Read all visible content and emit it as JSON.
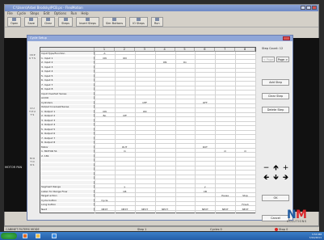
{
  "app": {
    "title": "C:\\Users\\Arbel Brodsky\\PCB.ps - FlexMotion",
    "menu": [
      "File",
      "Cycle",
      "Steps",
      "Edit",
      "Options",
      "Run",
      "Help"
    ],
    "toolbar": [
      "Open",
      "Save",
      "Clear",
      "Steps",
      "Insert Steps",
      "Sim Buttons",
      "IO Steps",
      "Run"
    ]
  },
  "dialog": {
    "title": "Cycle Setup",
    "step_count_label": "Step Count",
    "step_count_value": "12",
    "prev_page": "< Page",
    "next_page": "Page >",
    "buttons": {
      "add_step": "Add Step",
      "clear_step": "Clear Step",
      "delete_step": "Delete Step",
      "ok": "OK",
      "cancel": "Cancel"
    }
  },
  "grid": {
    "columns": [
      "",
      "1",
      "2",
      "3",
      "4",
      "5",
      "6",
      "7",
      "8"
    ],
    "rows": [
      {
        "name": "Input Type/Function",
        "cells": [
          "",
          "A",
          "",
          "",
          "",
          "",
          "",
          "",
          ""
        ]
      },
      {
        "name": "1. Input 1",
        "cells": [
          "",
          "ON",
          "ON",
          "",
          "",
          "",
          "",
          "",
          ""
        ]
      },
      {
        "name": "2. Input 2",
        "cells": [
          "",
          "",
          "",
          "",
          "ON",
          "On",
          "",
          "",
          ""
        ]
      },
      {
        "name": "3. Input 3",
        "cells": [
          "",
          "",
          "",
          "",
          "",
          "",
          "",
          "",
          ""
        ]
      },
      {
        "name": "4. Input 4",
        "cells": [
          "",
          "",
          "",
          "",
          "",
          "",
          "",
          "",
          ""
        ]
      },
      {
        "name": "5. Input 5",
        "cells": [
          "",
          "",
          "",
          "",
          "",
          "",
          "",
          "",
          ""
        ]
      },
      {
        "name": "6. Input 6",
        "cells": [
          "",
          "",
          "",
          "",
          "",
          "",
          "",
          "",
          ""
        ]
      },
      {
        "name": "7. Input 7",
        "cells": [
          "",
          "",
          "",
          "",
          "",
          "",
          "",
          "",
          ""
        ]
      },
      {
        "name": "8. Input 8",
        "cells": [
          "",
          "",
          "",
          "",
          "",
          "",
          "",
          "",
          ""
        ]
      },
      {
        "name": "Input Inverted Sense",
        "cells": [
          "",
          "",
          "",
          "",
          "",
          "",
          "",
          "",
          ""
        ]
      },
      {
        "name": "Air/Oil",
        "cells": [
          "",
          "",
          "",
          "",
          "",
          "",
          "",
          "",
          ""
        ]
      },
      {
        "name": "Cylinders",
        "cells": [
          "",
          "",
          "",
          "OFF",
          "",
          "",
          "OFF",
          "",
          ""
        ]
      },
      {
        "name": "Output Inversed/Sense",
        "cells": [
          "",
          "",
          "",
          "",
          "",
          "",
          "",
          "",
          ""
        ]
      },
      {
        "name": "1. Output 1",
        "cells": [
          "",
          "ON",
          "",
          "ON",
          "",
          "",
          "",
          "",
          ""
        ]
      },
      {
        "name": "2. Output 2",
        "cells": [
          "",
          "Bo",
          "Off",
          "",
          "",
          "",
          "",
          "",
          ""
        ]
      },
      {
        "name": "3. Output 3",
        "cells": [
          "",
          "",
          "",
          "",
          "",
          "",
          "",
          "",
          ""
        ]
      },
      {
        "name": "4. Output 4",
        "cells": [
          "",
          "",
          "",
          "",
          "",
          "",
          "",
          "",
          ""
        ]
      },
      {
        "name": "5. Output 5",
        "cells": [
          "",
          "",
          "",
          "",
          "",
          "",
          "",
          "",
          ""
        ]
      },
      {
        "name": "6. Output 6",
        "cells": [
          "",
          "",
          "",
          "",
          "",
          "",
          "",
          "",
          ""
        ]
      },
      {
        "name": "7. Output 7",
        "cells": [
          "",
          "",
          "",
          "",
          "",
          "",
          "",
          "",
          ""
        ]
      },
      {
        "name": "8. Output 8",
        "cells": [
          "",
          "",
          "",
          "",
          "",
          "",
          "",
          "",
          ""
        ]
      },
      {
        "name": "Motor",
        "cells": [
          "",
          "",
          "RUT",
          "",
          "",
          "",
          "RUT",
          "",
          ""
        ]
      },
      {
        "name": "1. MOTOR 51",
        "cells": [
          "",
          "",
          "m",
          "",
          "",
          "",
          "",
          "m",
          "m"
        ]
      },
      {
        "name": "2. 181",
        "cells": [
          "",
          "",
          "",
          "",
          "",
          "",
          "",
          "",
          ""
        ]
      },
      {
        "name": "",
        "cells": [
          "",
          "",
          "",
          "",
          "",
          "",
          "",
          "",
          ""
        ]
      },
      {
        "name": "",
        "cells": [
          "",
          "",
          "",
          "",
          "",
          "",
          "",
          "",
          ""
        ]
      },
      {
        "name": "",
        "cells": [
          "",
          "",
          "",
          "",
          "",
          "",
          "",
          "",
          ""
        ]
      },
      {
        "name": "",
        "cells": [
          "",
          "",
          "",
          "",
          "",
          "",
          "",
          "",
          ""
        ]
      },
      {
        "name": "",
        "cells": [
          "",
          "",
          "",
          "",
          "",
          "",
          "",
          "",
          ""
        ]
      },
      {
        "name": "",
        "cells": [
          "",
          "",
          "",
          "",
          "",
          "",
          "",
          "",
          ""
        ]
      },
      {
        "name": "Segment Range",
        "cells": [
          "",
          "",
          "y",
          "",
          "",
          "",
          "y",
          "",
          ""
        ]
      },
      {
        "name": "Listen for Range Flow",
        "cells": [
          "",
          "",
          "CB",
          "",
          "",
          "",
          "CB",
          "",
          ""
        ]
      },
      {
        "name": "Target action",
        "cells": [
          "",
          "",
          "",
          "",
          "",
          "",
          "",
          "Pause",
          "Stop"
        ]
      },
      {
        "name": "Cycle button",
        "cells": [
          "",
          "Cycle",
          "",
          "",
          "",
          "",
          "",
          "",
          ""
        ]
      },
      {
        "name": "Long button",
        "cells": [
          "",
          "",
          "",
          "",
          "",
          "",
          "",
          "",
          "Finish"
        ]
      },
      {
        "name": "Next",
        "cells": [
          "",
          "NEXT",
          "NEXT",
          "NEXT",
          "NEXT",
          "",
          "NEXT",
          "NEXT",
          "NEXT"
        ]
      }
    ]
  },
  "side_labels": [
    "I N P U T S",
    "O U T P U T S",
    "M O T O R S"
  ],
  "cyl_label": "MOTOR PAN",
  "statusbar": {
    "left": "CABINET FILTERS MODE",
    "step": "Step 1",
    "cycles": "Cycles 0",
    "stop": "Stop 0"
  },
  "taskbar": {
    "time": "3:53 PM",
    "date": "7/22/2011"
  },
  "logo": {
    "n": "N",
    "m": "M",
    "sub": "SOLUTIONS"
  }
}
